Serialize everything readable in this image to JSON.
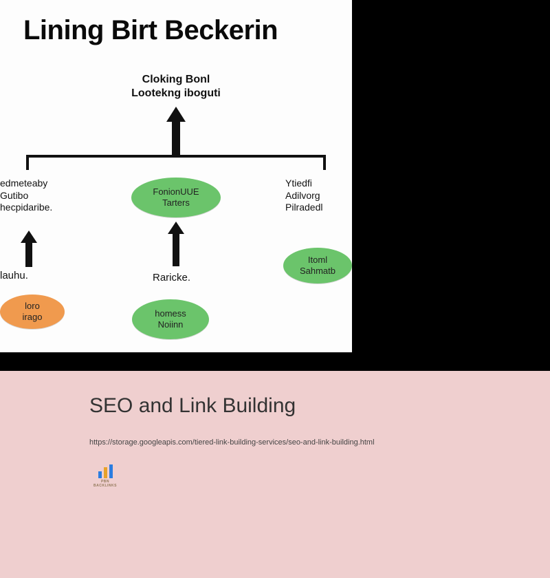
{
  "diagram": {
    "title": "Lining Birt Beckerin",
    "top_label_line1": "Cloking Bonl",
    "top_label_line2": "Lootekng iboguti",
    "nodes": {
      "mid_center_line1": "FonionUUE",
      "mid_center_line2": "Tarters",
      "right_mid_line1": "Itoml",
      "right_mid_line2": "Sahmatb",
      "bottom_center_line1": "homess",
      "bottom_center_line2": "Noiinn",
      "bottom_left_line1": "loro",
      "bottom_left_line2": "irago"
    },
    "labels": {
      "left_mid_line1": "edmeteaby",
      "left_mid_line2": "Gutibo",
      "left_mid_line3": "hecpidaribe.",
      "right_mid_line1": "Ytiedfi",
      "right_mid_line2": "Adilvorg",
      "right_mid_line3": "Pilradedl",
      "left_lower": "lauhu.",
      "center_lower": "Raricke."
    }
  },
  "footer": {
    "title": "SEO and Link Building",
    "url": "https://storage.googleapis.com/tiered-link-building-services/seo-and-link-building.html",
    "logo_caption": "PBN BACKLINKS"
  },
  "colors": {
    "green": "#6bc46b",
    "orange": "#f09a4e",
    "footer_bg": "#efcfcf"
  }
}
